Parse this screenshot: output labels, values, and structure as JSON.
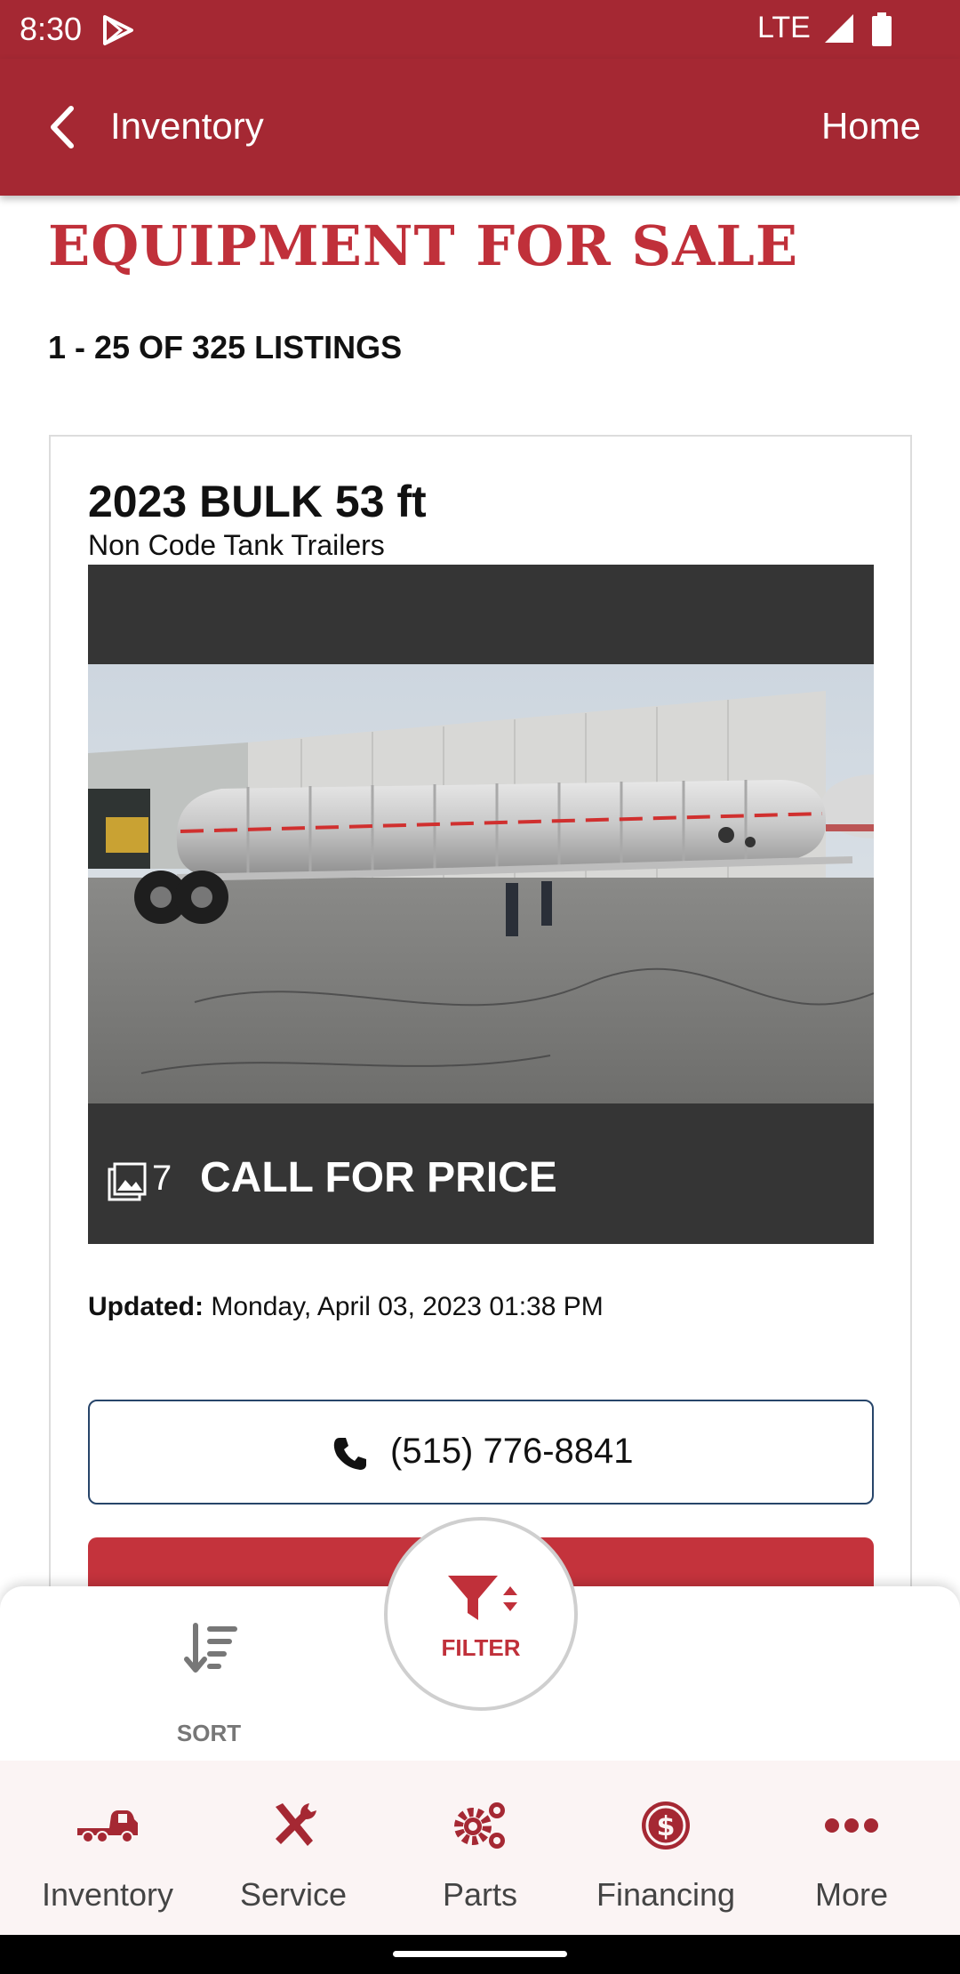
{
  "status_bar": {
    "time": "8:30",
    "network": "LTE"
  },
  "app_bar": {
    "title": "Inventory",
    "home_label": "Home"
  },
  "page": {
    "title": "EQUIPMENT FOR SALE",
    "listing_count": "1 - 25 OF 325 LISTINGS"
  },
  "listing": {
    "title": "2023 BULK 53 ft",
    "subtitle": "Non Code Tank Trailers",
    "photo_count": "7",
    "price": "CALL FOR PRICE",
    "updated_label": "Updated:",
    "updated_value": "Monday, April 03, 2023 01:38 PM",
    "phone": "(515) 776-8841"
  },
  "sheet": {
    "sort_label": "SORT",
    "filter_label": "FILTER"
  },
  "bottom_nav": {
    "items": [
      {
        "label": "Inventory",
        "icon": "truck-icon"
      },
      {
        "label": "Service",
        "icon": "tools-icon"
      },
      {
        "label": "Parts",
        "icon": "gears-icon"
      },
      {
        "label": "Financing",
        "icon": "dollar-circle-icon"
      },
      {
        "label": "More",
        "icon": "more-dots-icon"
      }
    ]
  },
  "colors": {
    "brand": "#a52833",
    "accent": "#c0303a",
    "nav_icon": "#a52833"
  }
}
